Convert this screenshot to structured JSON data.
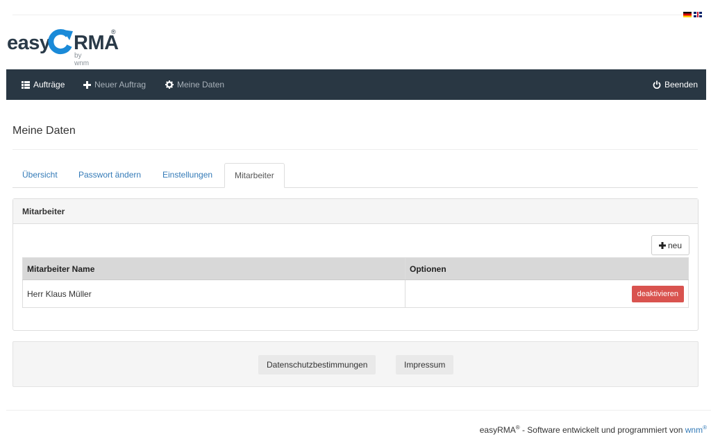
{
  "languages": [
    {
      "code": "de",
      "icon": "flag-de-icon"
    },
    {
      "code": "en",
      "icon": "flag-uk-icon"
    }
  ],
  "logo": {
    "easy": "easy",
    "rma": "RMA",
    "reg": "®",
    "by": "by wnm"
  },
  "nav": {
    "items": [
      {
        "label": "Aufträge",
        "icon": "list-icon",
        "active": true
      },
      {
        "label": "Neuer Auftrag",
        "icon": "plus-icon",
        "active": false
      },
      {
        "label": "Meine Daten",
        "icon": "gear-icon",
        "active": false
      }
    ],
    "logout_label": "Beenden",
    "logout_icon": "power-icon"
  },
  "page_title": "Meine Daten",
  "tabs": [
    {
      "label": "Übersicht",
      "active": false
    },
    {
      "label": "Passwort ändern",
      "active": false
    },
    {
      "label": "Einstellungen",
      "active": false
    },
    {
      "label": "Mitarbeiter",
      "active": true
    }
  ],
  "panel": {
    "title": "Mitarbeiter",
    "new_button": "neu",
    "table": {
      "headers": [
        "Mitarbeiter Name",
        "Optionen"
      ],
      "rows": [
        {
          "name": "Herr Klaus Müller",
          "action": "deaktivieren"
        }
      ]
    }
  },
  "footer": {
    "privacy": "Datenschutzbestimmungen",
    "imprint": "Impressum"
  },
  "copyright": {
    "brand": "easyRMA",
    "reg": "®",
    "text": " - Software entwickelt und programmiert von ",
    "link": "wnm",
    "link_reg": "®"
  },
  "colors": {
    "navbar": "#293743",
    "accent": "#1a8ad8",
    "link": "#337ab7",
    "danger": "#d9534f"
  }
}
